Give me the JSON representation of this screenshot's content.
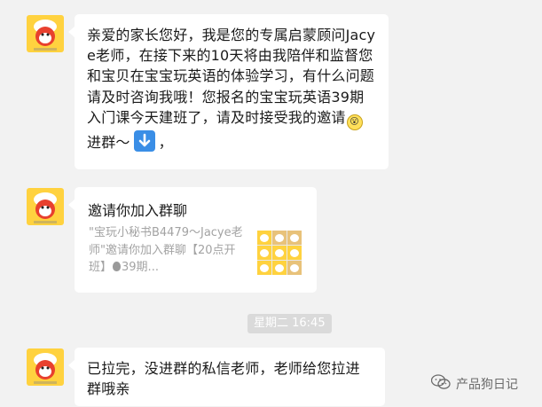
{
  "messages": [
    {
      "id": "welcome",
      "text_part1": "亲爱的家长您好，我是您的专属启蒙顾问Jacye老师，在接下来的10天将由我陪伴和监督您和宝贝在宝宝玩英语的体验学习，有什么问题请及时咨询我哦！您报名的宝宝玩英语39期入门课今天建班了，请及时接受我的邀请",
      "emoji_label": "😮",
      "text_part2": "进群～",
      "text_part3": "，",
      "icon": "down-arrow-icon"
    },
    {
      "id": "invite-card",
      "title": "邀请你加入群聊",
      "desc_part1": "\"宝玩小秘书B4479～Jacye老师\"邀请你加入群聊【20点开班】",
      "desc_part2": "39期..."
    },
    {
      "id": "reply",
      "text": "已拉完，没进群的私信老师，老师给您拉进群哦亲"
    }
  ],
  "timestamp": "星期二 16:45",
  "watermark": {
    "text": "产品狗日记",
    "icon": "wechat-icon"
  },
  "colors": {
    "background": "#f2f2f2",
    "bubble": "#ffffff",
    "avatar": "#ffd23f",
    "timestamp_bg": "#dadada",
    "down_arrow": "#3a8ee6"
  }
}
